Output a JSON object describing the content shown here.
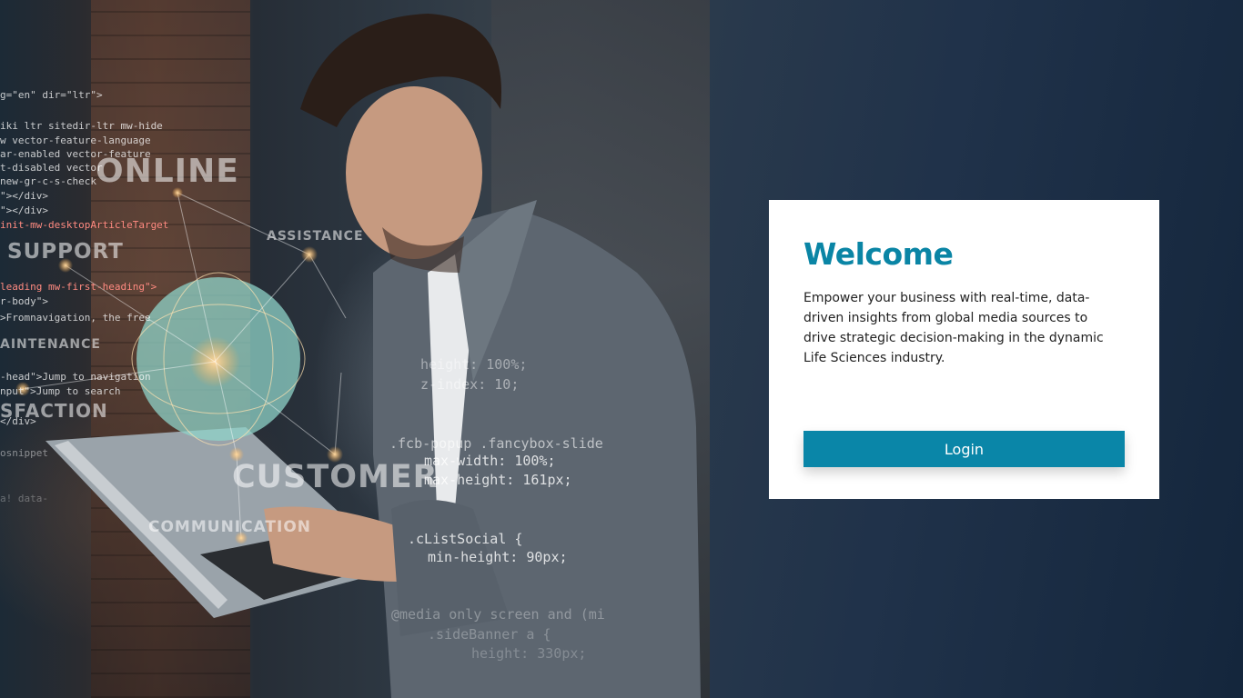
{
  "hero": {
    "words": {
      "online": "ONLINE",
      "support": "SUPPORT",
      "assistance": "ASSISTANCE",
      "maintenance": "AINTENANCE",
      "satisfaction": "SFACTION",
      "customer": "CUSTOMER",
      "communication": "COMMUNICATION"
    },
    "code_left": [
      "g=\"en\" dir=\"ltr\">",
      "iki ltr sitedir-ltr mw-hide",
      "w vector-feature-language",
      "ar-enabled vector-feature",
      "t-disabled vector",
      "new-gr-c-s-check",
      "\"></div>",
      "\"></div>",
      "init-mw-desktopArticleTarget",
      "leading mw-first-heading\">",
      "r-body\">",
      ">Fromnavigation, the free",
      "-head\">Jump to navigation",
      "nput\">Jump to search",
      "</div>",
      "osnippet",
      "a! data-"
    ],
    "code_right": [
      "height: 100%;",
      "z-index: 10;",
      ".fcb-popup .fancybox-slide",
      "max-width: 100%;",
      "max-height: 161px;",
      ".cListSocial {",
      "min-height: 90px;",
      "@media only screen and (mi",
      ".sideBanner a {",
      "height: 330px;"
    ]
  },
  "card": {
    "title": "Welcome",
    "description": "Empower your business with real-time, data-driven insights from global media sources to drive strategic decision-making in the dynamic Life Sciences industry.",
    "login_label": "Login"
  },
  "colors": {
    "accent": "#0a86a8",
    "title": "#0a85a5",
    "panel_bg": "#1c2e44"
  }
}
